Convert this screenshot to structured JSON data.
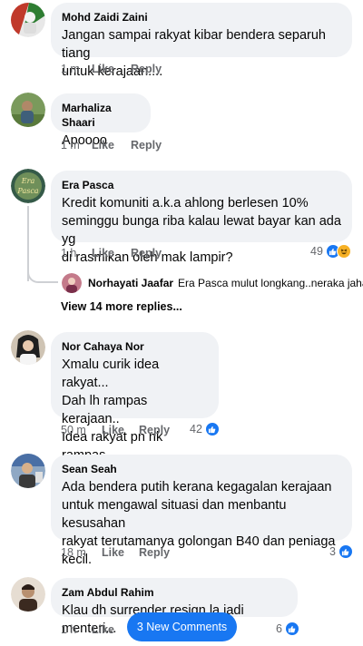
{
  "comments": [
    {
      "author": "Mohd Zaidi Zaini",
      "text": "Jangan sampai rakyat kibar bendera separuh tiang\nuntuk kerajaan....",
      "time": "1 m",
      "like": "Like",
      "reply": "Reply",
      "avatar_colors": [
        "#c0392b",
        "#2e7d32"
      ]
    },
    {
      "author": "Marhaliza Shaari",
      "text": "Apoooo",
      "time": "1 m",
      "like": "Like",
      "reply": "Reply",
      "avatar_colors": [
        "#6d8f4e",
        "#a0785a"
      ]
    },
    {
      "author": "Era Pasca",
      "text": "Kredit komuniti a.k.a ahlong berlesen 10%\nseminggu bunga riba kalau lewat bayar kan ada yg\ndi rasmikan oleh mak lampir?",
      "time": "1 h",
      "like": "Like",
      "reply": "Reply",
      "reaction_count": "49",
      "avatar_text": "Era Pasca",
      "avatar_colors": [
        "#2e5d4a",
        "#88a060"
      ]
    },
    {
      "author": "Nor Cahaya Nor",
      "text": "Xmalu curik idea rakyat...\nDah lh rampas kerajaan..\nIdea rakyat pn nk rampas...\nJenis muka xtau malu",
      "time": "50 m",
      "like": "Like",
      "reply": "Reply",
      "reaction_count": "42",
      "avatar_colors": [
        "#2b2b2b",
        "#d9c7b0"
      ]
    },
    {
      "author": "Sean Seah",
      "text": "Ada bendera putih kerana kegagalan kerajaan\nuntuk mengawal situasi dan menbantu kesusahan\nrakyat terutamanya golongan B40 dan peniaga\nkecil.",
      "time": "18 m",
      "like": "Like",
      "reply": "Reply",
      "reaction_count": "3",
      "avatar_colors": [
        "#4a6fa5",
        "#c9a27e"
      ]
    },
    {
      "author": "Zam Abdul Rahim",
      "text": "Klau dh surrender resign la jadi menteri...",
      "time": "1 h",
      "like": "Like",
      "reaction_count": "6",
      "avatar_colors": [
        "#3b2a20",
        "#c7a88a"
      ]
    }
  ],
  "nested_reply": {
    "author": "Norhayati Jaafar",
    "text": "Era Pasca mulut longkang..neraka jaha..."
  },
  "view_more_replies": "View 14 more replies...",
  "new_comments_button": "3 New Comments",
  "colors": {
    "accent": "#1877f2",
    "bubble": "#f0f2f5",
    "meta": "#65676b"
  },
  "icons": [
    "like-reaction-icon",
    "haha-reaction-icon"
  ]
}
